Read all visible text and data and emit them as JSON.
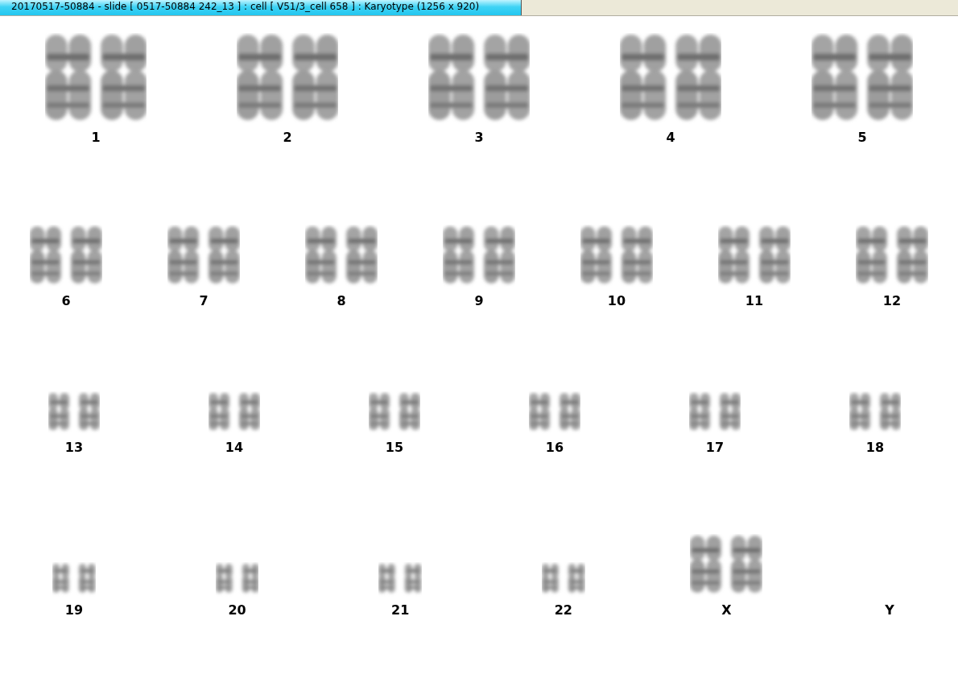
{
  "window": {
    "title": "20170517-50884 - slide [ 0517-50884 242_13 ] : cell [ V51/3_cell 658 ] : Karyotype  (1256 x 920)"
  },
  "karyotype": {
    "rows": [
      {
        "groups": [
          {
            "label": "1",
            "kind": "large"
          },
          {
            "label": "2",
            "kind": "large"
          },
          {
            "label": "3",
            "kind": "large"
          },
          {
            "label": "4",
            "kind": "large"
          },
          {
            "label": "5",
            "kind": "large"
          }
        ]
      },
      {
        "groups": [
          {
            "label": "6",
            "kind": "medium"
          },
          {
            "label": "7",
            "kind": "medium"
          },
          {
            "label": "8",
            "kind": "medium"
          },
          {
            "label": "9",
            "kind": "medium"
          },
          {
            "label": "10",
            "kind": "medium"
          },
          {
            "label": "11",
            "kind": "medium"
          },
          {
            "label": "12",
            "kind": "medium"
          }
        ]
      },
      {
        "groups": [
          {
            "label": "13",
            "kind": "small"
          },
          {
            "label": "14",
            "kind": "small"
          },
          {
            "label": "15",
            "kind": "small"
          },
          {
            "label": "16",
            "kind": "small"
          },
          {
            "label": "17",
            "kind": "small"
          },
          {
            "label": "18",
            "kind": "small"
          }
        ]
      },
      {
        "groups": [
          {
            "label": "19",
            "kind": "tiny"
          },
          {
            "label": "20",
            "kind": "tiny"
          },
          {
            "label": "21",
            "kind": "tiny"
          },
          {
            "label": "22",
            "kind": "tiny"
          },
          {
            "label": "X",
            "kind": "medium"
          },
          {
            "label": "Y",
            "kind": "empty"
          }
        ]
      }
    ]
  }
}
